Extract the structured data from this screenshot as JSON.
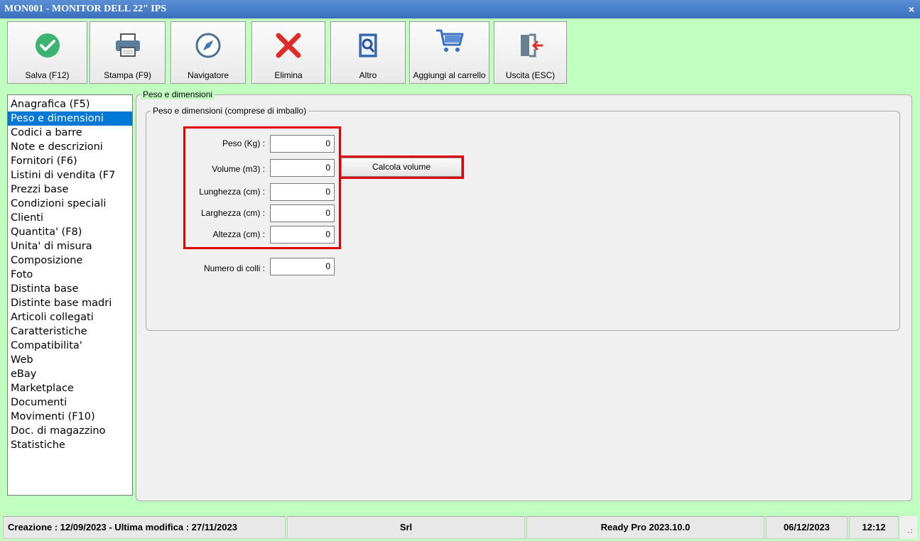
{
  "window": {
    "title": "MON001 - MONITOR DELL 22\" IPS",
    "close_glyph": "×"
  },
  "toolbar": [
    {
      "label": "Salva (F12)",
      "icon": "check-circle-icon"
    },
    {
      "label": "Stampa (F9)",
      "icon": "printer-icon"
    },
    {
      "label": "Navigatore",
      "icon": "compass-icon"
    },
    {
      "label": "Elimina",
      "icon": "delete-x-icon"
    },
    {
      "label": "Altro",
      "icon": "book-search-icon"
    },
    {
      "label": "Aggiungi al carrello",
      "icon": "cart-icon"
    },
    {
      "label": "Uscita (ESC)",
      "icon": "exit-door-icon"
    }
  ],
  "nav": {
    "items": [
      "Anagrafica (F5)",
      "Peso e dimensioni",
      "Codici a barre",
      "Note e descrizioni",
      "Fornitori (F6)",
      "Listini di vendita (F7",
      "Prezzi base",
      "Condizioni speciali",
      "Clienti",
      "Quantita' (F8)",
      "Unita' di misura",
      "Composizione",
      "Foto",
      "Distinta base",
      "Distinte base madri",
      "Articoli collegati",
      "Caratteristiche",
      "Compatibilita'",
      "Web",
      "eBay",
      "Marketplace",
      "Documenti",
      "Movimenti (F10)",
      "Doc. di magazzino",
      "Statistiche"
    ],
    "selected": "Peso e dimensioni"
  },
  "panel": {
    "title": "Peso e dimensioni",
    "group_title": "Peso e dimensioni (comprese di imballo)",
    "fields": {
      "peso": {
        "label": "Peso (Kg) :",
        "value": "0"
      },
      "volume": {
        "label": "Volume (m3) :",
        "value": "0"
      },
      "lunghezza": {
        "label": "Lunghezza (cm) :",
        "value": "0"
      },
      "larghezza": {
        "label": "Larghezza (cm) :",
        "value": "0"
      },
      "altezza": {
        "label": "Altezza (cm) :",
        "value": "0"
      },
      "colli": {
        "label": "Numero di colli :",
        "value": "0"
      }
    },
    "calc_button": "Calcola volume"
  },
  "statusbar": {
    "dates": "Creazione : 12/09/2023 - Ultima modifica : 27/11/2023",
    "company": "Srl",
    "version": "Ready Pro 2023.10.0",
    "date": "06/12/2023",
    "time": "12:12"
  },
  "colors": {
    "background": "#c0ffc0",
    "title_bar": "#3a6fbf",
    "selection": "#0078d7",
    "highlight": "#e00000"
  }
}
